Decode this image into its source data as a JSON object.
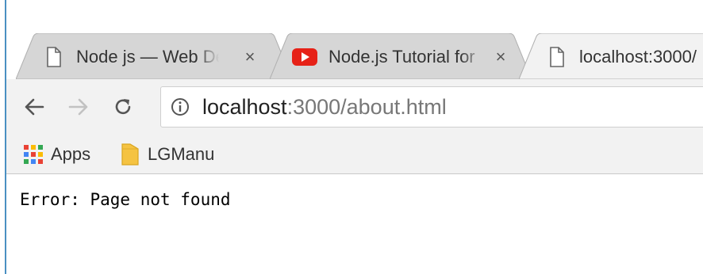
{
  "browser": {
    "tabs": [
      {
        "title": "Node js — Web Dev",
        "icon": "page-icon",
        "active": false
      },
      {
        "title": "Node.js Tutorial for",
        "icon": "youtube-icon",
        "active": false
      },
      {
        "title": "localhost:3000/",
        "icon": "page-icon",
        "active": true
      }
    ],
    "close_glyph": "×",
    "address": {
      "host": "localhost",
      "rest": ":3000/about.html"
    },
    "bookmarks": [
      {
        "label": "Apps",
        "icon": "apps-grid-icon"
      },
      {
        "label": "LGManu",
        "icon": "folder-icon"
      }
    ]
  },
  "page": {
    "message": "Error: Page not found"
  },
  "colors": {
    "accent_edge": "#4a90c2",
    "youtube_red": "#e62117",
    "folder_yellow": "#f5c342"
  }
}
